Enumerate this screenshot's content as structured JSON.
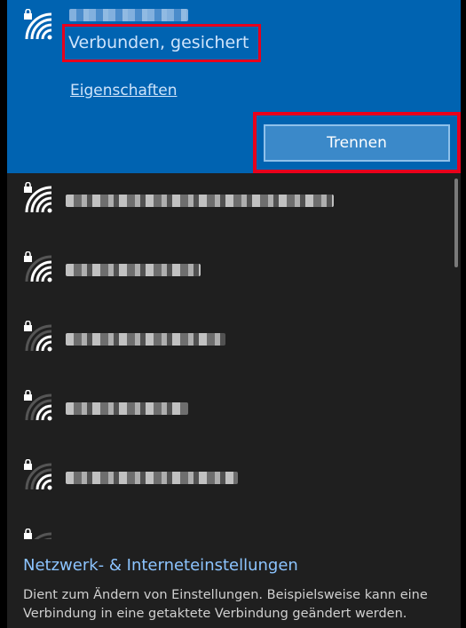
{
  "connected_network": {
    "status": "Verbunden, gesichert",
    "properties_label": "Eigenschaften",
    "disconnect_label": "Trennen"
  },
  "networks": [
    {
      "secured": true,
      "signal": 4
    },
    {
      "secured": true,
      "signal": 3
    },
    {
      "secured": true,
      "signal": 2
    },
    {
      "secured": true,
      "signal": 2
    },
    {
      "secured": true,
      "signal": 2
    },
    {
      "secured": true,
      "signal": 1
    }
  ],
  "footer": {
    "settings_link": "Netzwerk- & Interneteinstellungen",
    "settings_description": "Dient zum Ändern von Einstellungen. Beispielsweise kann eine Verbindung in eine getaktete Verbindung geändert werden."
  },
  "colors": {
    "connected_bg": "#0063b1",
    "panel_bg": "#1f1f1f",
    "highlight": "#e8001c",
    "link": "#8cc4ff"
  },
  "icons": {
    "wifi": "wifi-secured-icon",
    "lock": "lock-icon"
  }
}
